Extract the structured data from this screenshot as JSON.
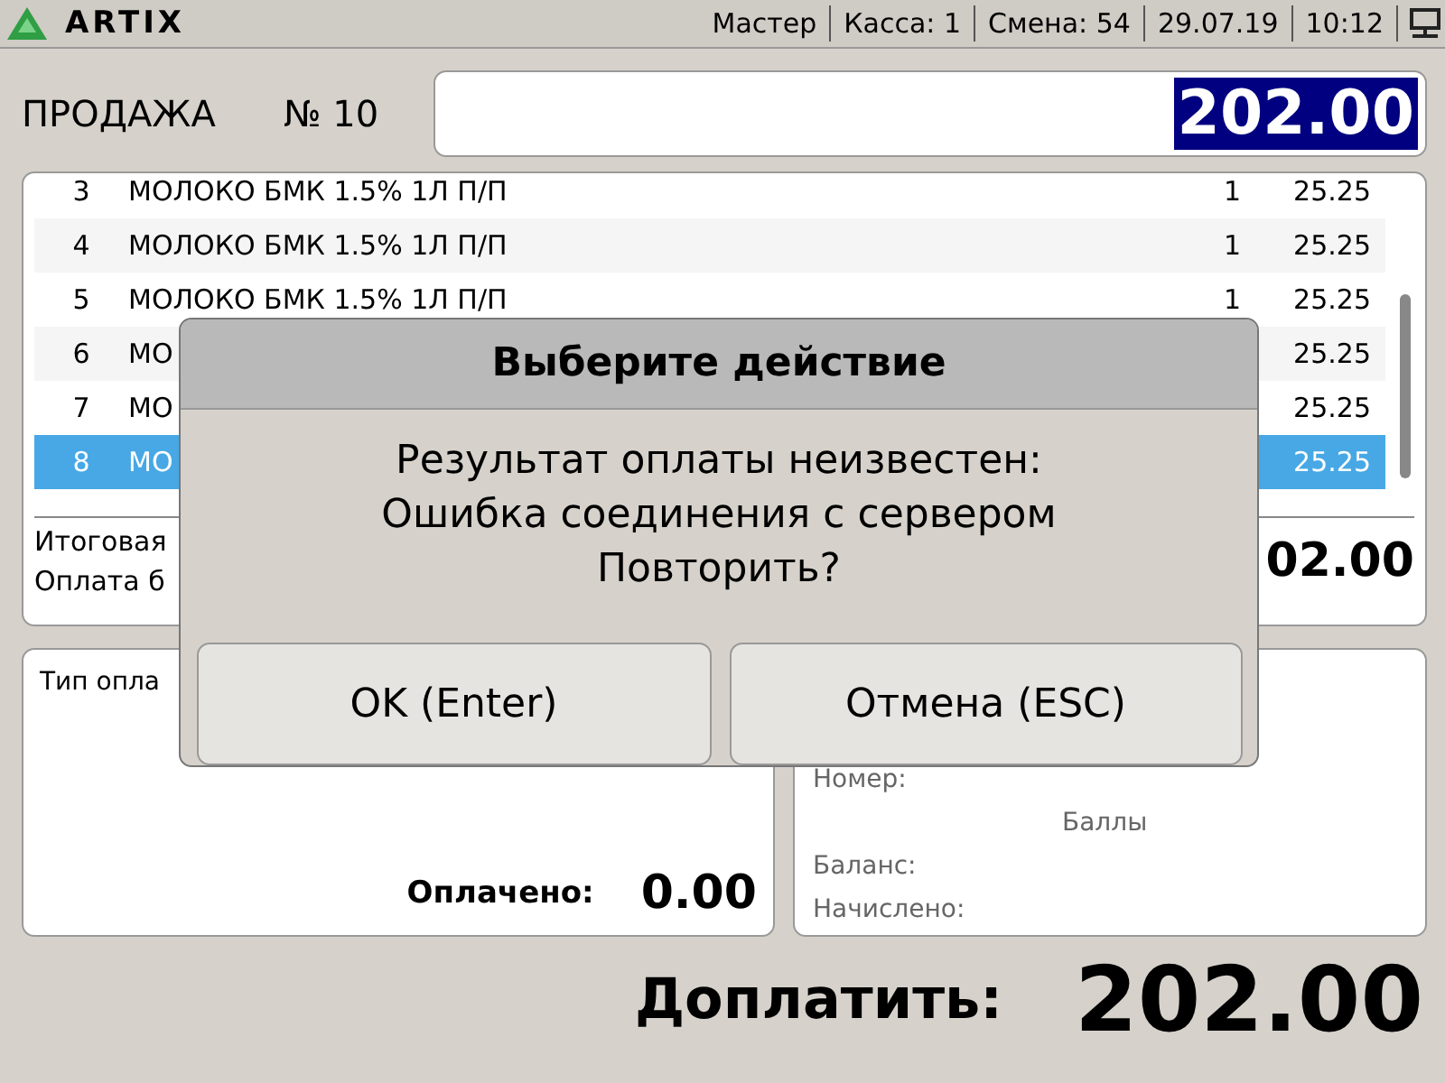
{
  "header": {
    "logo": "ARTIX",
    "items": [
      "Мастер",
      "Касса: 1",
      "Смена: 54",
      "29.07.19",
      "10:12"
    ]
  },
  "sale": {
    "title": "ПРОДАЖА",
    "number": "№ 10",
    "amount": "202.00"
  },
  "table": {
    "rows": [
      {
        "num": "3",
        "name": "МОЛОКО БМК 1.5% 1Л П/П",
        "qty": "1",
        "price": "25.25",
        "selected": false
      },
      {
        "num": "4",
        "name": "МОЛОКО БМК 1.5% 1Л П/П",
        "qty": "1",
        "price": "25.25",
        "selected": false
      },
      {
        "num": "5",
        "name": "МОЛОКО БМК 1.5% 1Л П/П",
        "qty": "1",
        "price": "25.25",
        "selected": false
      },
      {
        "num": "6",
        "name": "МО",
        "price": "25.25",
        "selected": false
      },
      {
        "num": "7",
        "name": "МО",
        "price": "25.25",
        "selected": false
      },
      {
        "num": "8",
        "name": "МО",
        "price": "25.25",
        "selected": true
      }
    ]
  },
  "totals": {
    "total_label": "Итоговая",
    "payment_label": "Оплата б",
    "total_value": "02.00"
  },
  "payment": {
    "label": "Тип опла",
    "paid_label": "Оплачено:",
    "paid_value": "0.00"
  },
  "card": {
    "fields": [
      "Номер:",
      "Баланс:",
      "Начислено:"
    ],
    "points": "Баллы"
  },
  "due": {
    "label": "Доплатить:",
    "value": "202.00"
  },
  "dialog": {
    "title": "Выберите действие",
    "message": [
      "Результат оплаты неизвестен:",
      "Ошибка соединения с сервером",
      "Повторить?"
    ],
    "buttons": [
      "OK (Enter)",
      "Отмена (ESC)"
    ]
  }
}
